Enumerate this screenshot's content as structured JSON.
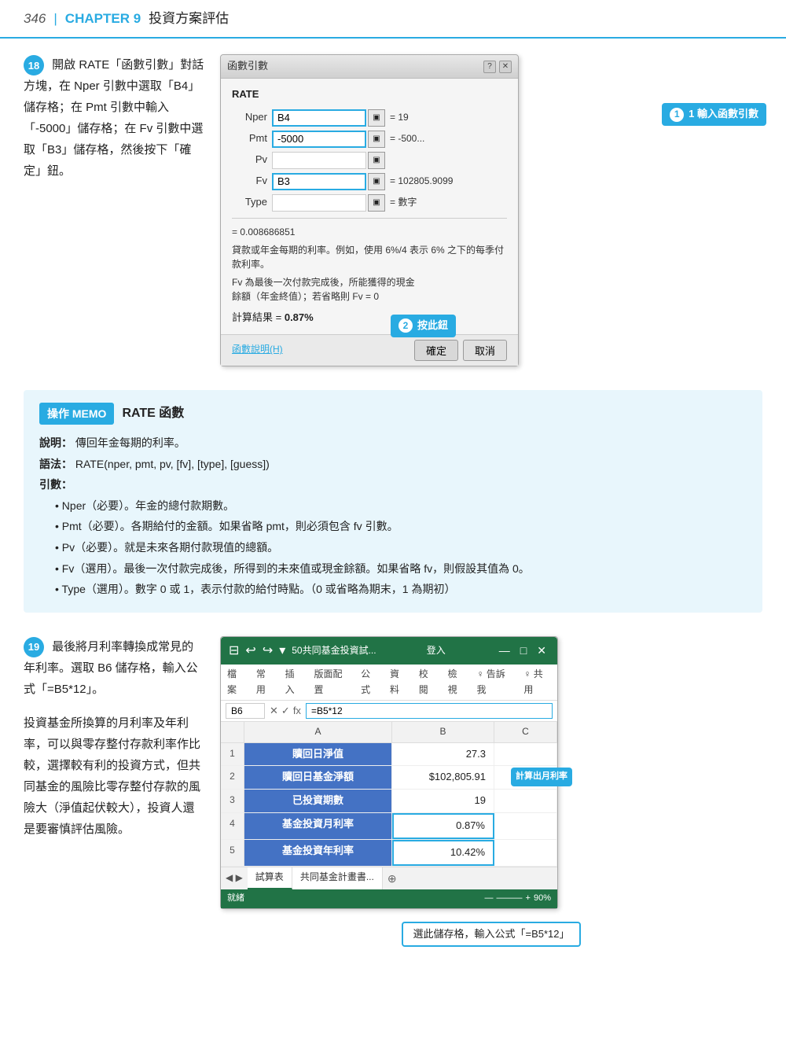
{
  "header": {
    "page_number": "346",
    "divider": "|",
    "chapter_label": "CHAPTER 9",
    "chapter_title": "投資方案評估"
  },
  "step18": {
    "number": "18",
    "text_lines": [
      "開啟 RATE「函數引數」對話方",
      "塊，在 Nper 引數中選取「B4」",
      "儲存格；在 Pmt 引數中輸入",
      "「-5000」儲存格；在 Fv 引數中",
      "選取「B3」儲存格，然後按下",
      "「確定」鈕。"
    ],
    "dialog": {
      "title": "函數引數",
      "func_name": "RATE",
      "fields": [
        {
          "label": "Nper",
          "value": "B4",
          "equals": "= 19"
        },
        {
          "label": "Pmt",
          "value": "-5000",
          "equals": "= -500..."
        },
        {
          "label": "Pv",
          "value": "",
          "equals": ""
        },
        {
          "label": "Fv",
          "value": "B3",
          "equals": "= 102805.9099"
        },
        {
          "label": "Type",
          "value": "",
          "equals": "= 數字"
        }
      ],
      "result_text1": "= 0.008686851",
      "description1": "貸款或年金每期的利率。例如，使用 6%/4 表示 6% 之下的每季付款利率。",
      "description2": "Fv 為最後一次付款完成後，所能獲得的現金",
      "description3": "餘額（年金終值）；若省略則 Fv = 0",
      "calc_label": "計算結果 =",
      "calc_value": "0.87%",
      "help_link": "函數說明(H)",
      "ok_btn": "確定",
      "cancel_btn": "取消"
    },
    "callout1": "1 輸入函數引數",
    "callout2": "2 按此鈕"
  },
  "memo": {
    "tag": "操作 MEMO",
    "title": "RATE 函數",
    "description_label": "說明：",
    "description_text": "傳回年金每期的利率。",
    "syntax_label": "語法：",
    "syntax_text": "RATE(nper, pmt, pv, [fv], [type], [guess])",
    "args_label": "引數：",
    "args": [
      "• Nper（必要）。年金的總付款期數。",
      "• Pmt（必要）。各期給付的金額。如果省略 pmt，則必須包含 fv 引數。",
      "• Pv（必要）。就是未來各期付款現值的總額。",
      "• Fv（選用）。最後一次付款完成後，所得到的未來值或現金餘額。如果省略 fv，則假設其值為 0。",
      "• Type（選用）。數字 0 或 1，表示付款的給付時點。（0 或省略為期末，1 為期初）"
    ]
  },
  "step19": {
    "number": "19",
    "text_block1": [
      "最後將月利率轉換成常見的年利",
      "率。選取 B6 儲存格，輸入公式",
      "「=B5*12」。"
    ],
    "text_block2": [
      "投資基金所換算的月利率及年利",
      "率，可以與零存整付存款利率作",
      "比較，選擇較有利的投資方式，",
      "但共同基金的風險比零存整付存",
      "款的風險大（淨值起伏較大），投",
      "資人還是要審慎評估風險。"
    ],
    "excel": {
      "title": "50共同基金投資試...",
      "login": "登入",
      "toolbar_icons": [
        "⊟",
        "↩",
        "↪",
        "▼"
      ],
      "ribbon_items": [
        "檔案",
        "常用",
        "插入",
        "版面配置",
        "公式",
        "資料",
        "校閱",
        "檢視",
        "♀ 告訴我",
        "♀ 共用"
      ],
      "cell_ref": "B6",
      "formula": "=B5*12",
      "col_headers": [
        "",
        "A",
        "B",
        "C"
      ],
      "rows": [
        {
          "num": "1",
          "col_a": "贖回日淨值",
          "col_b": "27.3",
          "col_c": ""
        },
        {
          "num": "2",
          "col_a": "贖回日基金淨額",
          "col_b": "$102,805.91",
          "col_c": ""
        },
        {
          "num": "3",
          "col_a": "已投資期數",
          "col_b": "19",
          "col_c": ""
        },
        {
          "num": "4",
          "col_a": "基金投資月利率",
          "col_b": "0.87%",
          "col_c": ""
        },
        {
          "num": "5",
          "col_a": "基金投資年利率",
          "col_b": "10.42%",
          "col_c": ""
        }
      ],
      "sheet_tabs": [
        "試算表",
        "共同基金計畫書..."
      ],
      "status": "就緒",
      "zoom": "90%",
      "calc_tag": "計算出月利率"
    },
    "callout_bottom": "選此儲存格，輸入公式「=B5*12」"
  }
}
